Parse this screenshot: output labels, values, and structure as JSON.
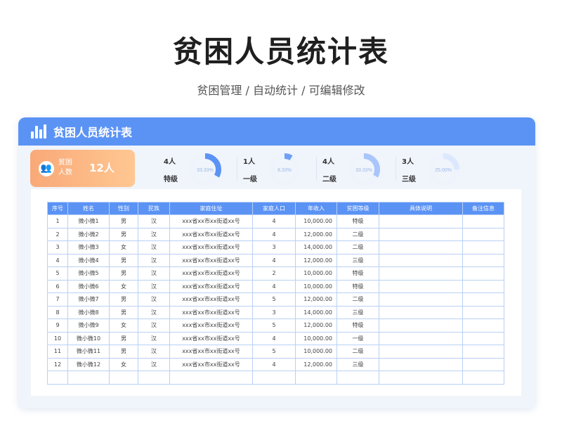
{
  "page": {
    "title": "贫困人员统计表",
    "subtitle": "贫困管理 / 自动统计 /  可编辑修改"
  },
  "panel": {
    "header_title": "贫困人员统计表",
    "total": {
      "label": "贫困人数",
      "value": "12人"
    },
    "levels": [
      {
        "count": "4人",
        "name": "特级",
        "percent": "33.33%",
        "fraction": 0.3333,
        "color": "#5b93f5"
      },
      {
        "count": "1人",
        "name": "一级",
        "percent": "8.33%",
        "fraction": 0.0833,
        "color": "#6fa0f6"
      },
      {
        "count": "4人",
        "name": "二级",
        "percent": "33.33%",
        "fraction": 0.3333,
        "color": "#a9c6fa"
      },
      {
        "count": "3人",
        "name": "三级",
        "percent": "25.00%",
        "fraction": 0.25,
        "color": "#dce8fd"
      }
    ]
  },
  "table": {
    "headers": [
      "序号",
      "姓名",
      "性别",
      "民族",
      "家庭住址",
      "家庭人口",
      "年收入",
      "贫困等级",
      "具体说明",
      "备注信息"
    ],
    "rows": [
      [
        "1",
        "微小微1",
        "男",
        "汉",
        "xxx省xx市xx街道xx号",
        "4",
        "10,000.00",
        "特级",
        "",
        ""
      ],
      [
        "2",
        "微小微2",
        "男",
        "汉",
        "xxx省xx市xx街道xx号",
        "4",
        "12,000.00",
        "二级",
        "",
        ""
      ],
      [
        "3",
        "微小微3",
        "女",
        "汉",
        "xxx省xx市xx街道xx号",
        "3",
        "14,000.00",
        "二级",
        "",
        ""
      ],
      [
        "4",
        "微小微4",
        "男",
        "汉",
        "xxx省xx市xx街道xx号",
        "4",
        "12,000.00",
        "三级",
        "",
        ""
      ],
      [
        "5",
        "微小微5",
        "男",
        "汉",
        "xxx省xx市xx街道xx号",
        "2",
        "10,000.00",
        "特级",
        "",
        ""
      ],
      [
        "6",
        "微小微6",
        "女",
        "汉",
        "xxx省xx市xx街道xx号",
        "4",
        "10,000.00",
        "特级",
        "",
        ""
      ],
      [
        "7",
        "微小微7",
        "男",
        "汉",
        "xxx省xx市xx街道xx号",
        "5",
        "12,000.00",
        "二级",
        "",
        ""
      ],
      [
        "8",
        "微小微8",
        "男",
        "汉",
        "xxx省xx市xx街道xx号",
        "3",
        "14,000.00",
        "三级",
        "",
        ""
      ],
      [
        "9",
        "微小微9",
        "女",
        "汉",
        "xxx省xx市xx街道xx号",
        "5",
        "12,000.00",
        "特级",
        "",
        ""
      ],
      [
        "10",
        "微小微10",
        "男",
        "汉",
        "xxx省xx市xx街道xx号",
        "4",
        "10,000.00",
        "一级",
        "",
        ""
      ],
      [
        "11",
        "微小微11",
        "男",
        "汉",
        "xxx省xx市xx街道xx号",
        "5",
        "10,000.00",
        "二级",
        "",
        ""
      ],
      [
        "12",
        "微小微12",
        "女",
        "汉",
        "xxx省xx市xx街道xx号",
        "4",
        "12,000.00",
        "三级",
        "",
        ""
      ],
      [
        "",
        "",
        "",
        "",
        "",
        "",
        "",
        "",
        "",
        ""
      ]
    ]
  }
}
